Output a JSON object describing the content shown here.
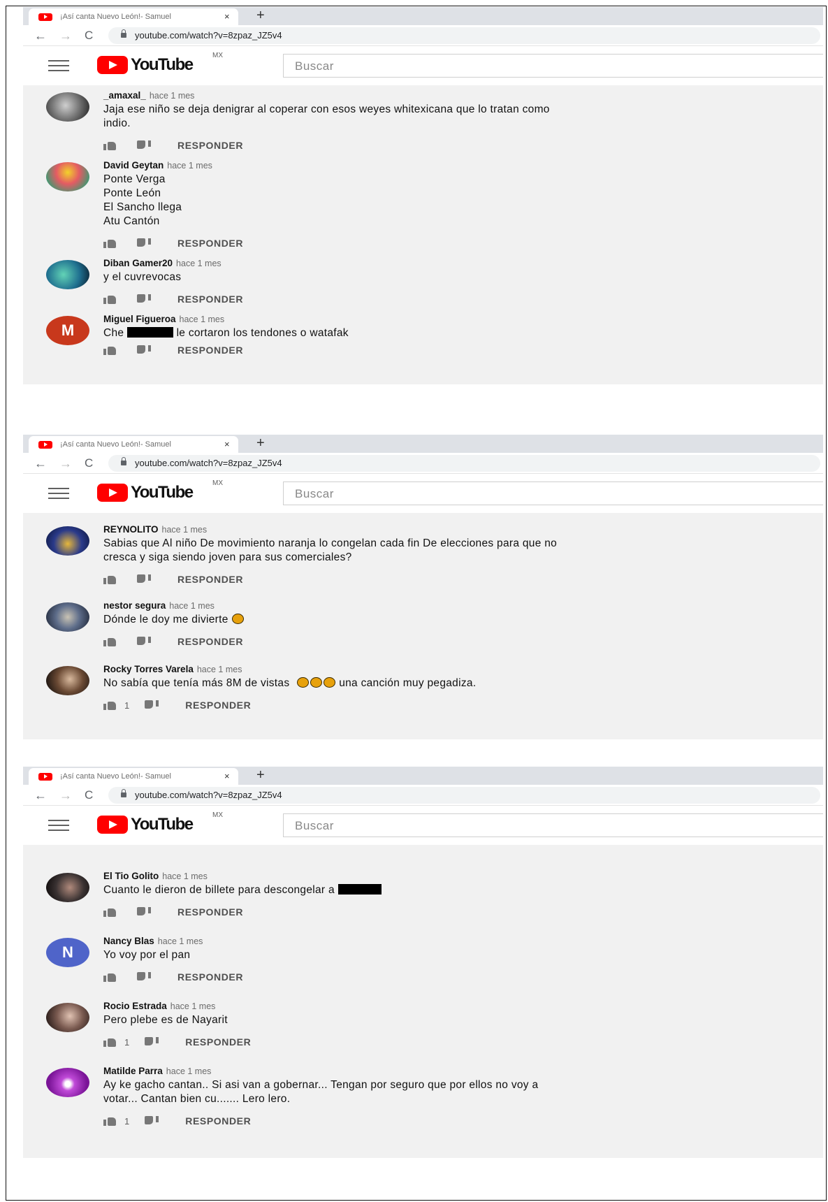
{
  "browser": {
    "tab_title": "¡Así canta Nuevo León!- Samuel",
    "tab_close": "×",
    "new_tab": "+",
    "url": "youtube.com/watch?v=8zpaz_JZ5v4",
    "back": "←",
    "forward": "→",
    "reload": "C"
  },
  "youtube": {
    "logo_text": "YouTube",
    "region": "MX",
    "search_placeholder": "Buscar",
    "reply_label": "RESPONDER"
  },
  "colors": {
    "brand_red": "#ff0000",
    "page_bg": "#f1f1f1"
  },
  "screenshots": [
    {
      "comments": [
        {
          "author": "_amaxal_",
          "time": "hace 1 mes",
          "lines": [
            "Jaja ese niño se deja denigrar al coperar con esos weyes whitexicana que lo tratan como",
            "indio."
          ],
          "likes": "",
          "avatar": {
            "type": "photo",
            "color": "#8a8a8a"
          }
        },
        {
          "author": "David Geytan",
          "time": "hace 1 mes",
          "lines": [
            "Ponte Verga",
            "Ponte León",
            "El Sancho llega",
            "Atu Cantón"
          ],
          "likes": "",
          "avatar": {
            "type": "photo",
            "color": "#c5474f"
          }
        },
        {
          "author": "Diban Gamer20",
          "time": "hace 1 mes",
          "lines": [
            "y el cuvrevocas"
          ],
          "likes": "",
          "avatar": {
            "type": "photo",
            "color": "#1f8f9a"
          }
        },
        {
          "author": "Miguel Figueroa",
          "time": "hace 1 mes",
          "lines": [
            "Che",
            "le cortaron los tendones o watafak"
          ],
          "redacted": true,
          "likes": "",
          "avatar": {
            "type": "letter",
            "letter": "M",
            "color": "#c8381c"
          }
        }
      ]
    },
    {
      "comments": [
        {
          "author": "REYNOLITO",
          "time": "hace 1 mes",
          "lines": [
            "Sabias que Al niño De movimiento naranja lo congelan cada  fin De elecciones para que no",
            "cresca  y siga  siendo  joven para sus comerciales?"
          ],
          "likes": "",
          "avatar": {
            "type": "photo",
            "color": "#39417a"
          }
        },
        {
          "author": "nestor segura",
          "time": "hace 1 mes",
          "lines": [
            "Dónde le doy me divierte"
          ],
          "emojis": 1,
          "likes": "",
          "avatar": {
            "type": "photo",
            "color": "#5e6d8a"
          }
        },
        {
          "author": "Rocky Torres Varela",
          "time": "hace 1 mes",
          "lines": [
            "No sabía que tenía más 8M de vistas",
            "una canción muy pegadiza."
          ],
          "emojis": 3,
          "likes": "1",
          "avatar": {
            "type": "photo",
            "color": "#4a3426"
          }
        }
      ]
    },
    {
      "comments": [
        {
          "author": "El Tio Golito",
          "time": "hace 1 mes",
          "lines": [
            "Cuanto le dieron de billete para descongelar a"
          ],
          "redacted_end": true,
          "likes": "",
          "avatar": {
            "type": "photo",
            "color": "#3a3232"
          }
        },
        {
          "author": "Nancy Blas",
          "time": "hace 1 mes",
          "lines": [
            "Yo voy por el pan"
          ],
          "likes": "",
          "avatar": {
            "type": "letter",
            "letter": "N",
            "color": "#4f64c9"
          }
        },
        {
          "author": "Rocio Estrada",
          "time": "hace 1 mes",
          "lines": [
            "Pero plebe es de Nayarit"
          ],
          "likes": "1",
          "avatar": {
            "type": "photo",
            "color": "#5a4a44"
          }
        },
        {
          "author": "Matilde Parra",
          "time": "hace 1 mes",
          "lines": [
            "Ay ke gacho cantan.. Si asi van a gobernar... Tengan por seguro que por ellos no voy a",
            "votar... Cantan bien cu....... Lero lero."
          ],
          "likes": "1",
          "avatar": {
            "type": "photo",
            "color": "#8a19a8"
          }
        }
      ]
    }
  ]
}
